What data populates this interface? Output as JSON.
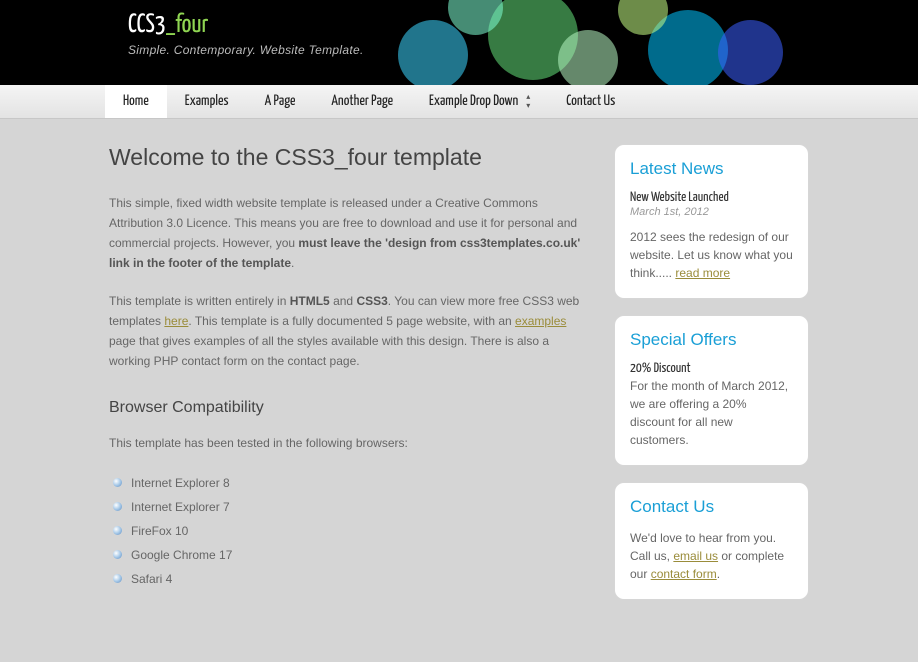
{
  "logo": {
    "part1": "CCS3",
    "part2": "_four",
    "subtitle": "Simple. Contemporary. Website Template."
  },
  "nav": {
    "items": [
      {
        "label": "Home",
        "active": true
      },
      {
        "label": "Examples"
      },
      {
        "label": "A Page"
      },
      {
        "label": "Another Page"
      },
      {
        "label": "Example Drop Down",
        "dropdown": true
      },
      {
        "label": "Contact Us"
      }
    ]
  },
  "main": {
    "title": "Welcome to the CSS3_four template",
    "p1_a": "This simple, fixed width website template is released under a Creative Commons Attribution 3.0 Licence. This means you are free to download and use it for personal and commercial projects. However, you ",
    "p1_b": "must leave the 'design from css3templates.co.uk' link in the footer of the template",
    "p1_c": ".",
    "p2_a": "This template is written entirely in ",
    "p2_b": "HTML5",
    "p2_c": " and ",
    "p2_d": "CSS3",
    "p2_e": ". You can view more free CSS3 web templates ",
    "p2_link1": "here",
    "p2_f": ". This template is a fully documented 5 page website, with an ",
    "p2_link2": "examples",
    "p2_g": " page that gives examples of all the styles available with this design. There is also a working PHP contact form on the contact page.",
    "h2": "Browser Compatibility",
    "p3": "This template has been tested in the following browsers:",
    "browsers": [
      "Internet Explorer 8",
      "Internet Explorer 7",
      "FireFox 10",
      "Google Chrome 17",
      "Safari 4"
    ]
  },
  "sidebar": {
    "news": {
      "heading": "Latest News",
      "item_title": "New Website Launched",
      "date": "March 1st, 2012",
      "body_a": "2012 sees the redesign of our website. Let us know what you think..... ",
      "link": "read more"
    },
    "offers": {
      "heading": "Special Offers",
      "item_title": "20% Discount",
      "body": "For the month of March 2012, we are offering a 20% discount for all new customers."
    },
    "contact": {
      "heading": "Contact Us",
      "body_a": "We'd love to hear from you. Call us, ",
      "link1": "email us",
      "body_b": " or complete our ",
      "link2": "contact form",
      "body_c": "."
    }
  }
}
